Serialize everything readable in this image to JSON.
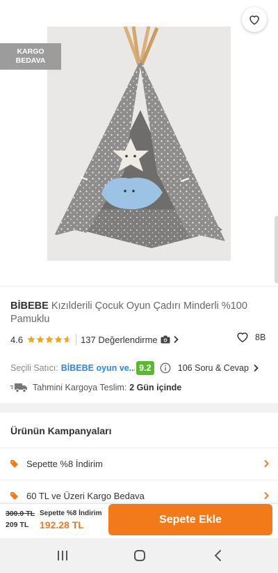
{
  "gallery": {
    "badge_line1": "KARGO",
    "badge_line2": "BEDAVA",
    "icons": {
      "back": "arrow-left-icon",
      "share": "share-icon",
      "favorite": "heart-outline-icon"
    }
  },
  "product": {
    "brand": "BİBEBE",
    "name": "Kızılderili Çocuk Oyun Çadırı Minderli %100 Pamuklu",
    "rating": "4.6",
    "rating_value": 4.6,
    "review_count_text": "137 Değerlendirme",
    "likes": "8B"
  },
  "seller": {
    "label": "Seçili Satıcı:",
    "name": "BİBEBE oyun ve...",
    "score": "9.2",
    "qa_link": "106 Soru & Cevap"
  },
  "shipping": {
    "label": "Tahmini Kargoya Teslim:",
    "value": "2 Gün içinde"
  },
  "campaigns": {
    "title": "Ürünün Kampanyaları",
    "items": [
      {
        "label": "Sepette %8 İndirim"
      },
      {
        "label": "60 TL ve Üzeri Kargo Bedava"
      }
    ]
  },
  "bottom_bar": {
    "old_price": "300.0 TL",
    "price": "209 TL",
    "promo_label": "Sepette %8 İndirim",
    "promo_price": "192.28 TL",
    "add_to_cart": "Sepete Ekle"
  },
  "colors": {
    "accent": "#f27a1a",
    "star": "#f6a416",
    "seller_link": "#2a8ae0",
    "score_badge": "#5bb830"
  }
}
